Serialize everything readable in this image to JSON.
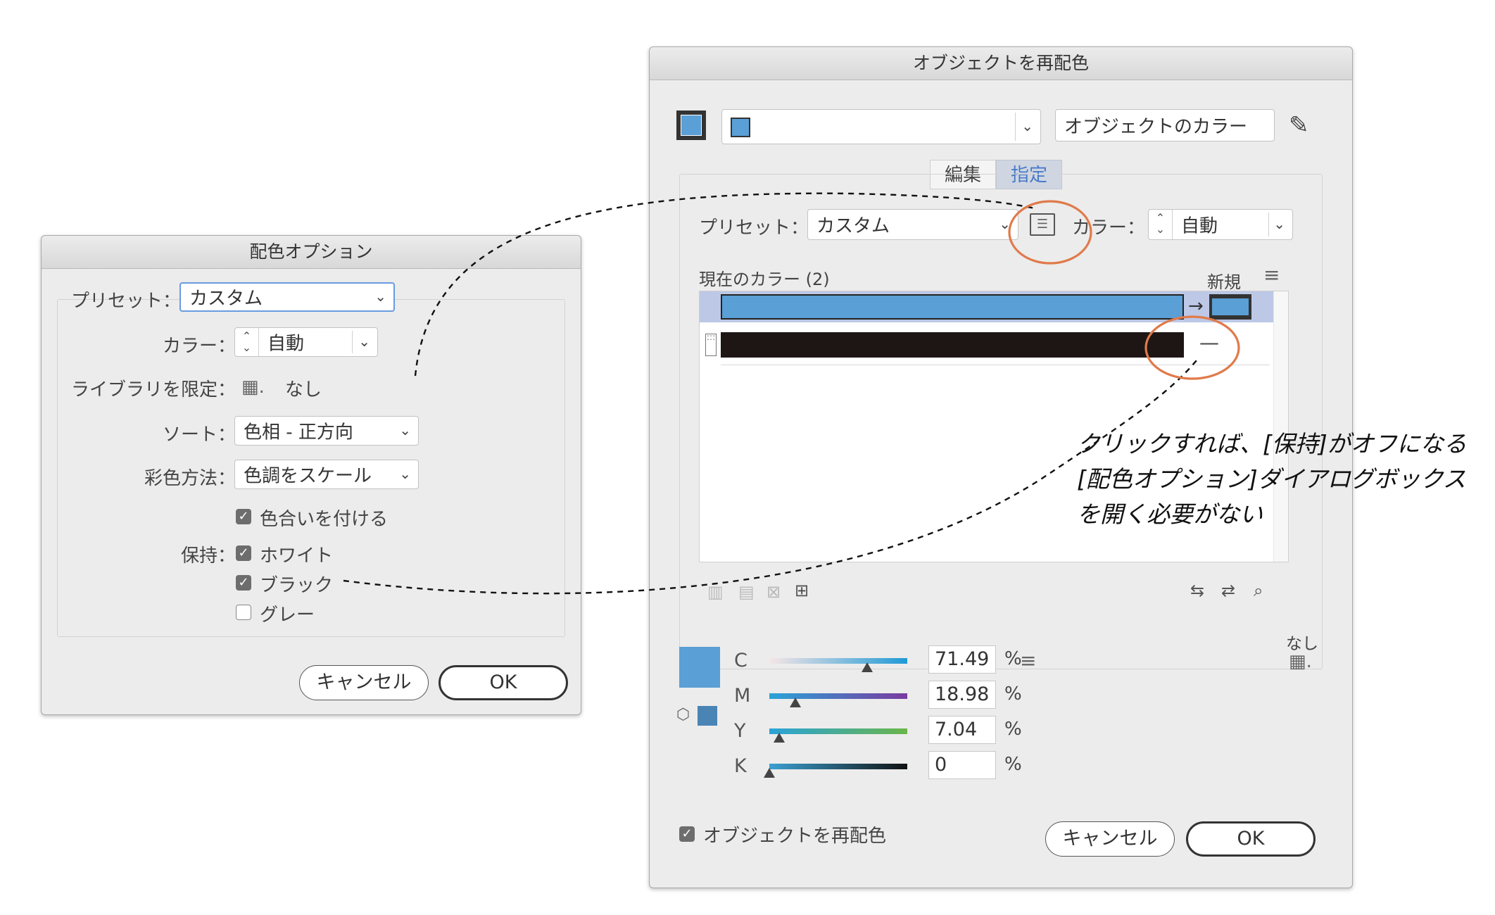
{
  "left_dialog": {
    "title": "配色オプション",
    "preset_label": "プリセット：",
    "preset_value": "カスタム",
    "color_label": "カラー：",
    "color_value": "自動",
    "library_label": "ライブラリを限定：",
    "library_value": "なし",
    "sort_label": "ソート：",
    "sort_value": "色相 - 正方向",
    "coloring_label": "彩色方法：",
    "coloring_value": "色調をスケール",
    "tint_checkbox": "色合いを付ける",
    "preserve_label": "保持：",
    "preserve_white": "ホワイト",
    "preserve_black": "ブラック",
    "preserve_gray": "グレー",
    "cancel": "キャンセル",
    "ok": "OK"
  },
  "right_dialog": {
    "title": "オブジェクトを再配色",
    "source_field": "オブジェクトのカラー",
    "tab_edit": "編集",
    "tab_assign": "指定",
    "preset_label": "プリセット：",
    "preset_value": "カスタム",
    "color_label": "カラー：",
    "color_value": "自動",
    "current_colors": "現在のカラー (2)",
    "new_label": "新規",
    "rows": [
      {
        "current": "#5a9fd6",
        "new": "#5a9fd6"
      },
      {
        "current": "#1e1615",
        "new": "—"
      }
    ],
    "none_label": "なし",
    "sliders": [
      {
        "label": "C",
        "value": "71.49",
        "unit": "%",
        "pos": 0.71
      },
      {
        "label": "M",
        "value": "18.98",
        "unit": "%",
        "pos": 0.19
      },
      {
        "label": "Y",
        "value": "7.04",
        "unit": "%",
        "pos": 0.07
      },
      {
        "label": "K",
        "value": "0",
        "unit": "%",
        "pos": 0.0
      }
    ],
    "recolor_checkbox": "オブジェクトを再配色",
    "cancel": "キャンセル",
    "ok": "OK",
    "swatch_color": "#5a9fd6"
  },
  "annotation": {
    "line1": "クリックすれば、[保持]がオフになる",
    "line2": "[配色オプション]ダイアログボックス",
    "line3": "を開く必要がない",
    "circle_color": "#e07a4a"
  }
}
